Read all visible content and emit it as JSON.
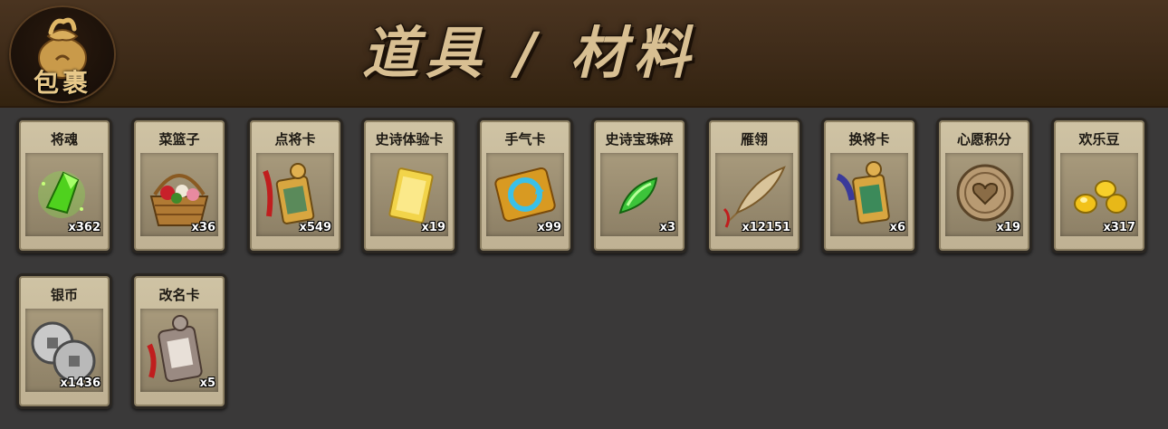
{
  "header": {
    "badge_label": "包裹",
    "title": "道具 / 材料"
  },
  "colors": {
    "header_bg": "#3d2a18",
    "page_bg": "#3a3939",
    "card_bg": "#cfc3a4",
    "title_text": "#d8bf92"
  },
  "items": [
    {
      "name": "将魂",
      "count": "x362",
      "icon": "green-crystal-icon"
    },
    {
      "name": "菜篮子",
      "count": "x36",
      "icon": "flower-basket-icon"
    },
    {
      "name": "点将卡",
      "count": "x549",
      "icon": "general-card-token-icon"
    },
    {
      "name": "史诗体验卡",
      "count": "x19",
      "icon": "gold-card-icon"
    },
    {
      "name": "手气卡",
      "count": "x99",
      "icon": "refresh-card-icon"
    },
    {
      "name": "史诗宝珠碎",
      "count": "x3",
      "icon": "green-shard-icon"
    },
    {
      "name": "雁翎",
      "count": "x12151",
      "icon": "feather-icon"
    },
    {
      "name": "换将卡",
      "count": "x6",
      "icon": "swap-card-token-icon"
    },
    {
      "name": "心愿积分",
      "count": "x19",
      "icon": "heart-coin-icon"
    },
    {
      "name": "欢乐豆",
      "count": "x317",
      "icon": "gold-beans-icon"
    },
    {
      "name": "银币",
      "count": "x1436",
      "icon": "silver-coins-icon"
    },
    {
      "name": "改名卡",
      "count": "x5",
      "icon": "rename-card-token-icon"
    }
  ]
}
